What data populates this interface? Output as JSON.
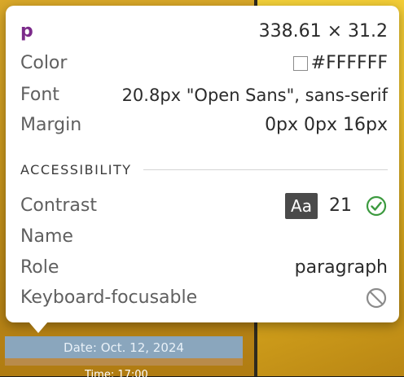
{
  "tooltip": {
    "element_tag": "p",
    "dimensions": "338.61 × 31.2",
    "color_label": "Color",
    "color_value": "#FFFFFF",
    "font_label": "Font",
    "font_value": "20.8px \"Open Sans\", sans-serif",
    "margin_label": "Margin",
    "margin_value": "0px 0px 16px",
    "section_title": "ACCESSIBILITY",
    "contrast_label": "Contrast",
    "contrast_badge": "Aa",
    "contrast_value": "21",
    "name_label": "Name",
    "name_value": "",
    "role_label": "Role",
    "role_value": "paragraph",
    "keyboard_label": "Keyboard-focusable"
  },
  "page": {
    "highlight_text": "Date: Oct. 12, 2024",
    "below_text": "Time: 17:00"
  },
  "colors": {
    "tag": "#7b2a8a",
    "check": "#3c9a3f",
    "ban": "#8b8b8b",
    "highlight": "#8aa6bd",
    "margin_overlay": "#b98b4a"
  },
  "icons": {
    "contrast_pass": "check-circle-icon",
    "keyboard": "ban-icon"
  }
}
